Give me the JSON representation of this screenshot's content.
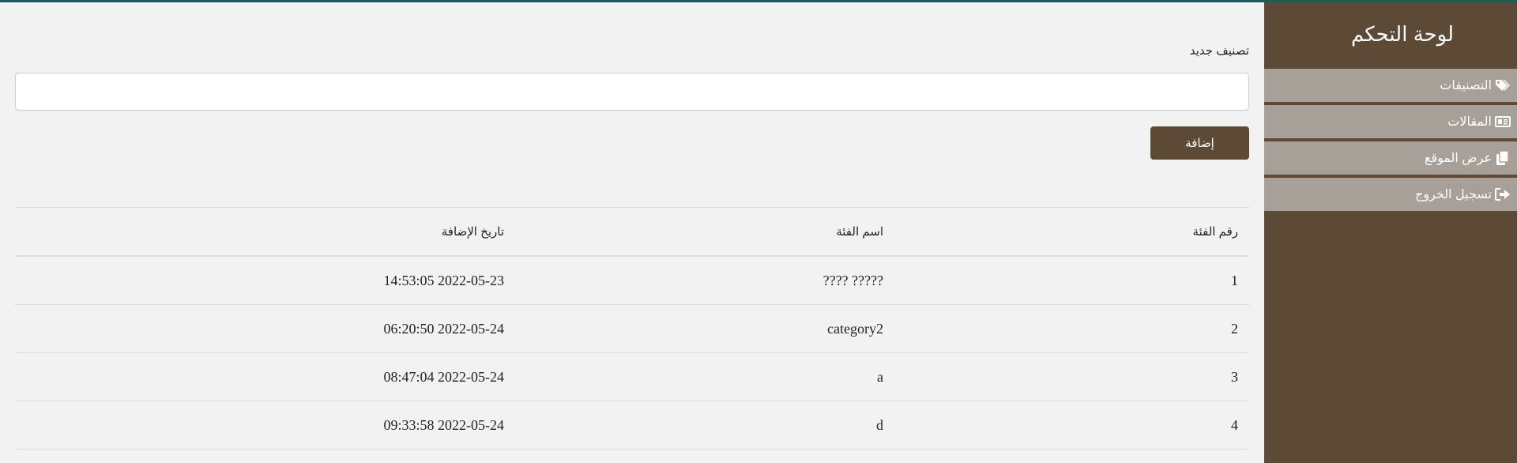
{
  "colors": {
    "sidebar_bg": "#5c4a37",
    "nav_item_bg": "#a7a098",
    "button_bg": "#5c4a37",
    "top_line": "#1d5d5d",
    "page_bg": "#f2f2f2"
  },
  "sidebar": {
    "title": "لوحة التحكم",
    "items": [
      {
        "label": "التصنيفات",
        "icon": "tags-icon"
      },
      {
        "label": "المقالات",
        "icon": "newspaper-icon"
      },
      {
        "label": "عرض الموقع",
        "icon": "copy-icon"
      },
      {
        "label": "تسجيل الخروج",
        "icon": "sign-out-icon"
      }
    ]
  },
  "form": {
    "label": "تصنيف جديد",
    "input_value": "",
    "input_placeholder": "",
    "add_button": "إضافة"
  },
  "table": {
    "headers": {
      "id": "رقم الفئة",
      "name": "اسم الفئة",
      "date": "تاريخ الإضافة"
    },
    "rows": [
      {
        "id": "1",
        "name": "????? ????",
        "date": "2022-05-23 14:53:05"
      },
      {
        "id": "2",
        "name": "category2",
        "date": "2022-05-24 06:20:50"
      },
      {
        "id": "3",
        "name": "a",
        "date": "2022-05-24 08:47:04"
      },
      {
        "id": "4",
        "name": "d",
        "date": "2022-05-24 09:33:58"
      }
    ]
  }
}
